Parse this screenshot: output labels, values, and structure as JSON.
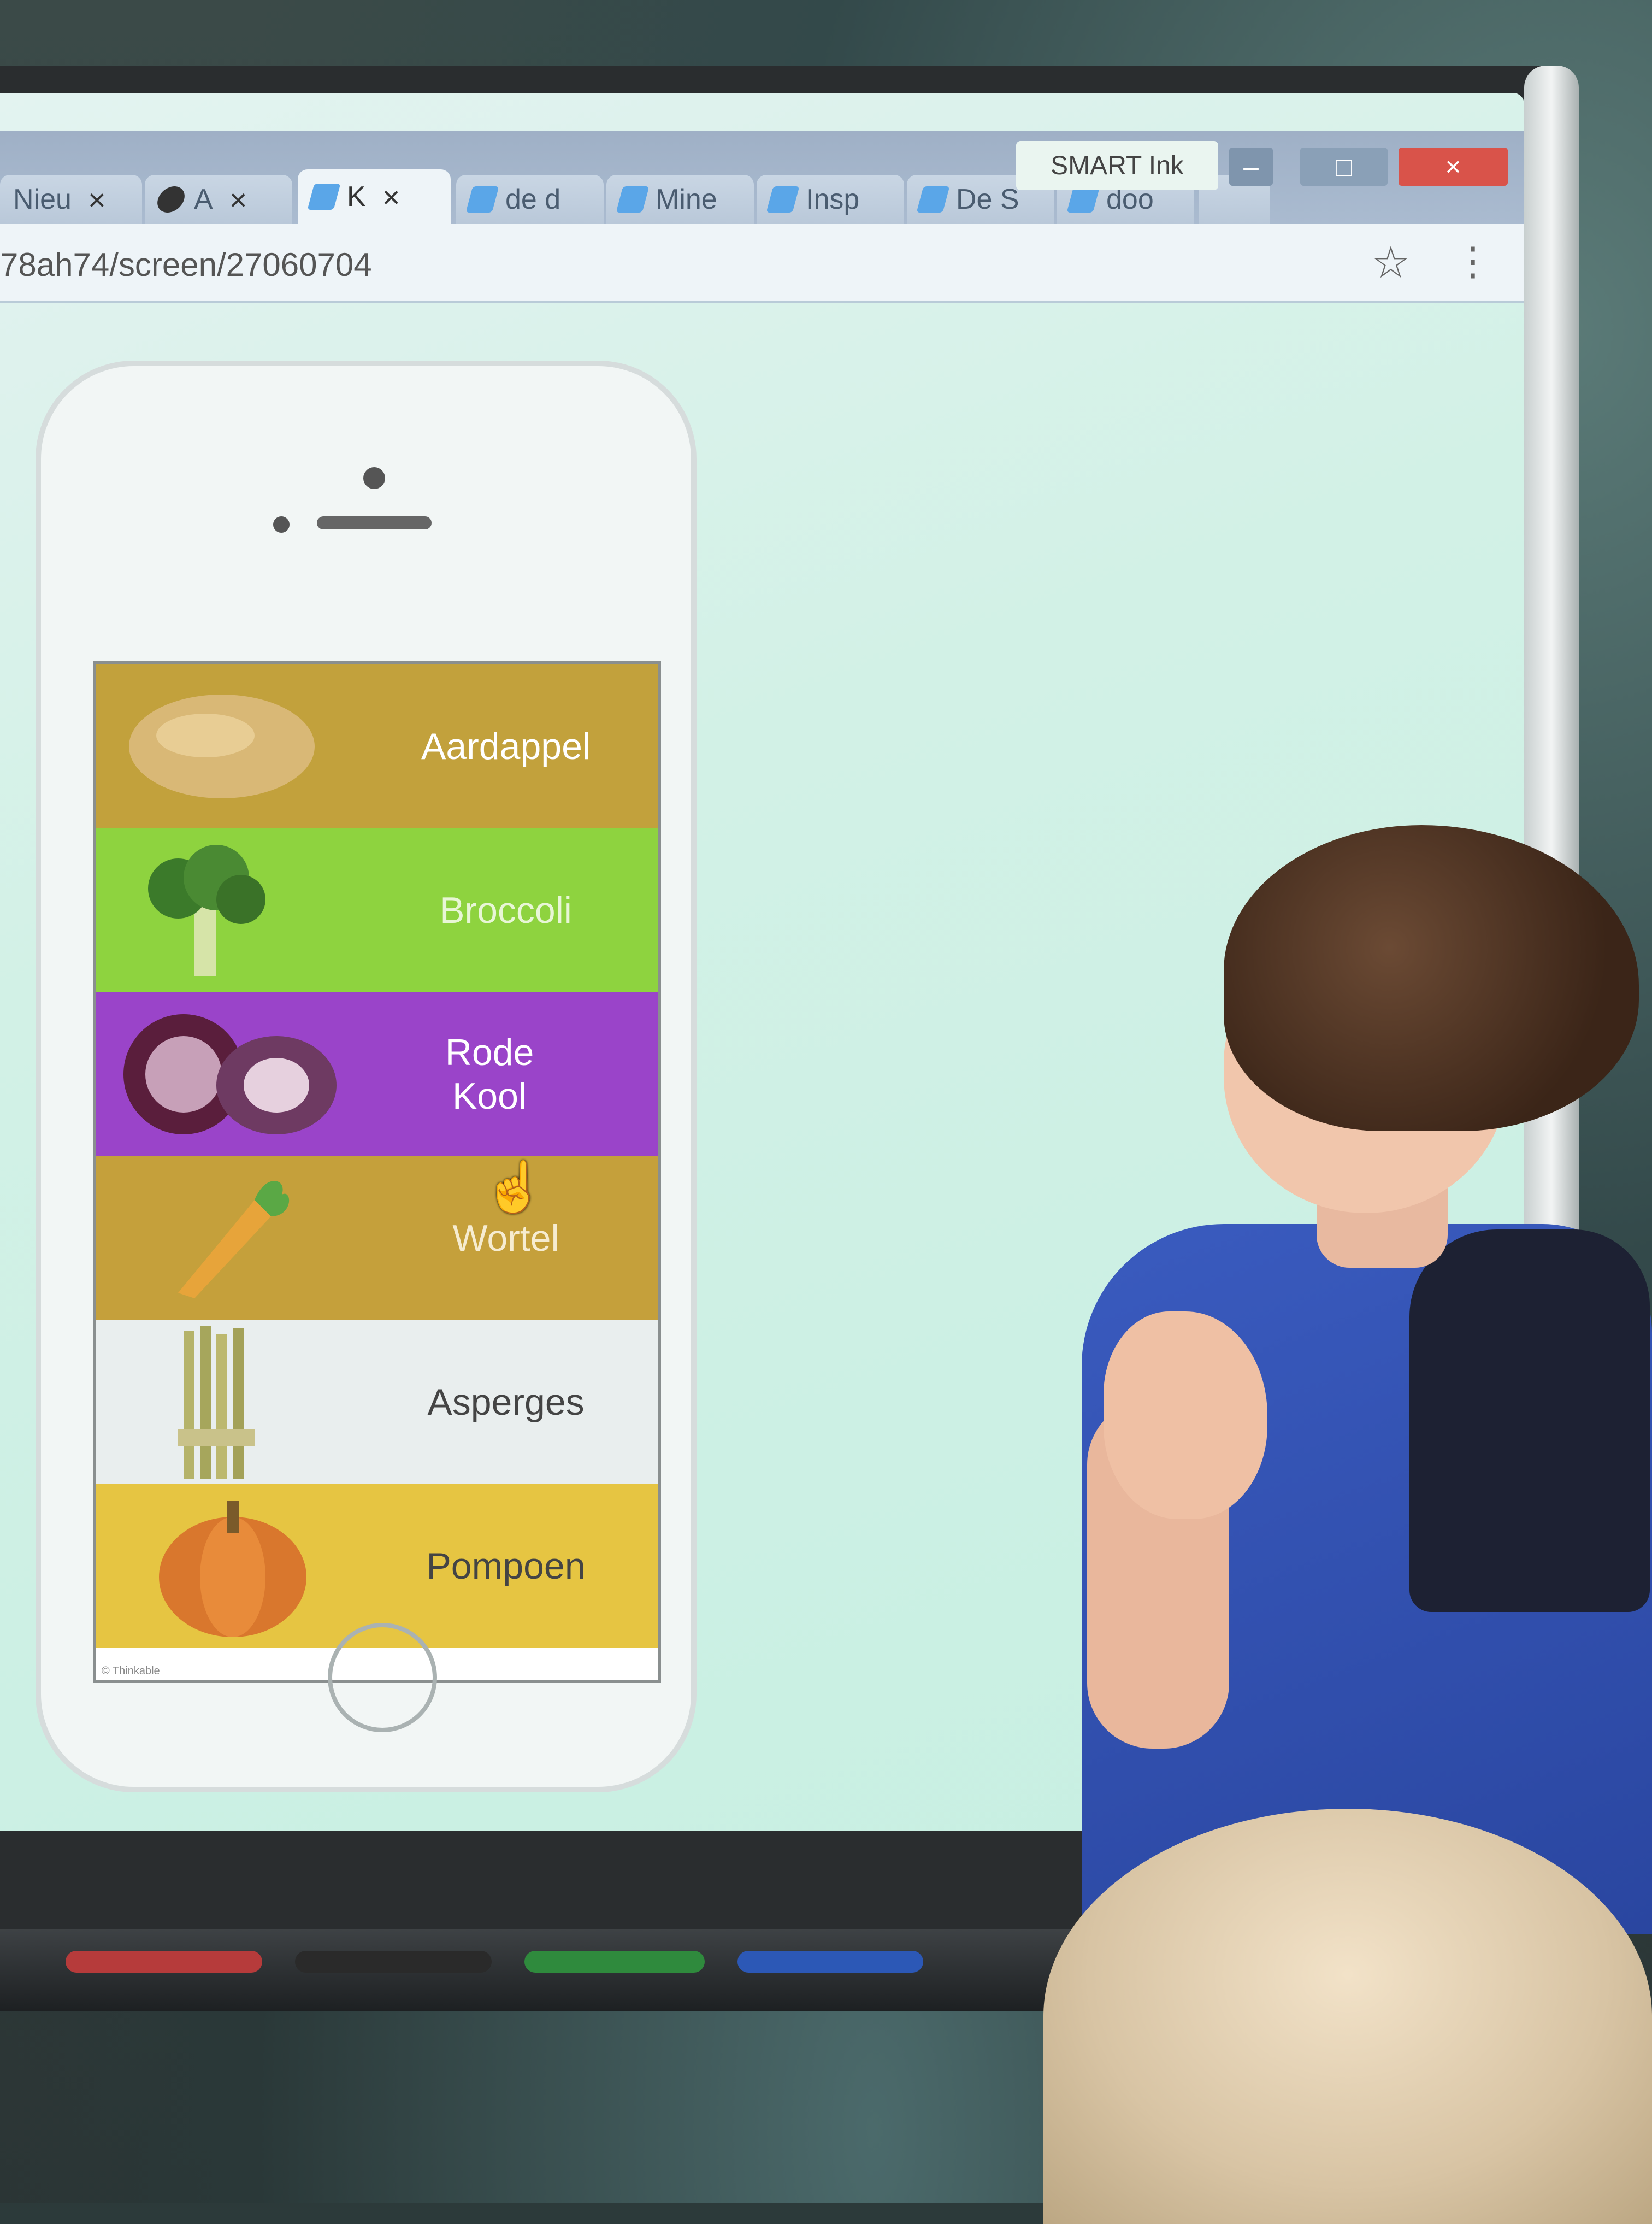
{
  "browser": {
    "tabs": [
      {
        "label": "Nieu",
        "icon": "page-icon",
        "close": "×"
      },
      {
        "label": "A",
        "icon": "yin-yang-icon",
        "close": "×"
      },
      {
        "label": "K",
        "icon": "feather-icon",
        "close": "×"
      },
      {
        "label": "de d",
        "icon": "feather-icon"
      },
      {
        "label": "Mine",
        "icon": "feather-icon"
      },
      {
        "label": "Insp",
        "icon": "feather-icon"
      },
      {
        "label": "De S",
        "icon": "feather-icon"
      },
      {
        "label": "doo",
        "icon": "feather-icon"
      }
    ],
    "url": "78ah74/screen/27060704",
    "smart_ink_label": "SMART Ink",
    "star_glyph": "☆",
    "menu_glyph": "⋮",
    "window_buttons": {
      "minimize": "–",
      "maximize": "□",
      "close": "×"
    }
  },
  "app": {
    "items": [
      {
        "label": "Aardappel",
        "color": "#c2a13c",
        "text_color": "#ffffff",
        "icon": "potato-icon"
      },
      {
        "label": "Broccoli",
        "color": "#8ed33f",
        "text_color": "#e8f6d6",
        "icon": "broccoli-icon"
      },
      {
        "label": "Rode Kool",
        "color": "#9a44c9",
        "text_color": "#ffffff",
        "icon": "red-cabbage-icon"
      },
      {
        "label": "Wortel",
        "color": "#c5a03b",
        "text_color": "#f6ecd0",
        "icon": "carrot-icon"
      },
      {
        "label": "Asperges",
        "color": "#e9eeee",
        "text_color": "#444444",
        "icon": "asparagus-icon"
      },
      {
        "label": "Pompoen",
        "color": "#e6c542",
        "text_color": "#444444",
        "icon": "pumpkin-icon"
      }
    ],
    "footer": "© Thinkable"
  }
}
